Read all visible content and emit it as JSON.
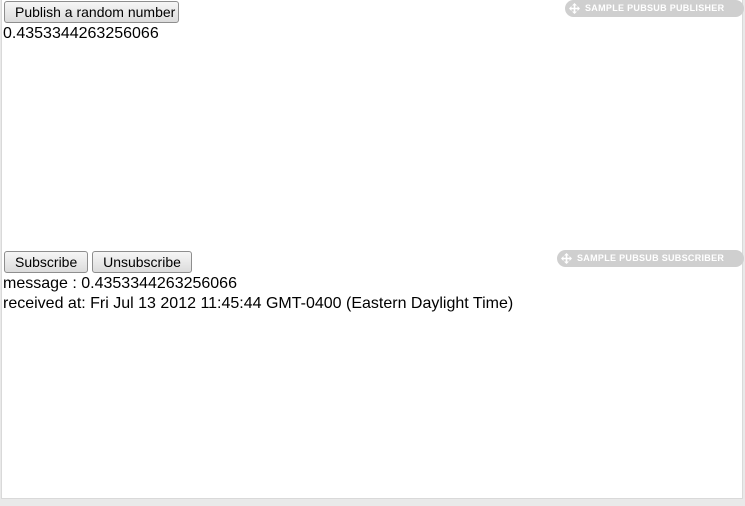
{
  "publisher": {
    "publish_button_label": "Publish a random number",
    "value": "0.4353344263256066",
    "badge_label": "SAMPLE PUBSUB PUBLISHER"
  },
  "subscriber": {
    "subscribe_button_label": "Subscribe",
    "unsubscribe_button_label": "Unsubscribe",
    "message_line": "message : 0.4353344263256066",
    "received_line": "received at: Fri Jul 13 2012 11:45:44 GMT-0400 (Eastern Daylight Time)",
    "badge_label": "SAMPLE PUBSUB SUBSCRIBER"
  },
  "icons": {
    "badge_icon": "move-icon"
  },
  "colors": {
    "badge_background": "#cfcfcf",
    "badge_text": "#ffffff",
    "page_background": "#e9e9e9"
  }
}
